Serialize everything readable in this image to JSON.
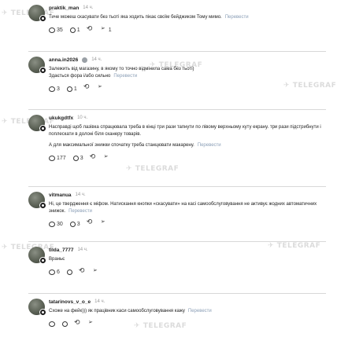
{
  "watermark_text": "TELEGRAF",
  "comments": [
    {
      "username": "praktik_man",
      "time": "14 ч.",
      "paragraphs": [
        "Тиче можеш скасувати без тьотi яка ходить пiкає своїм бейджиком Тому мимо."
      ],
      "translate": "Перевести",
      "likes": "35",
      "replies": "1",
      "shares": "1",
      "verified": false
    },
    {
      "username": "anna.in2026",
      "time": "14 ч.",
      "paragraphs": [
        "Залежить вiд магазину, в якому то точно вiдмiнила сама без тьотi)",
        "Здається фора i/або сильно"
      ],
      "translate": "Перевести",
      "likes": "3",
      "replies": "1",
      "shares": "",
      "verified": true
    },
    {
      "username": "ukukgdtfx",
      "time": "10 ч.",
      "paragraphs": [
        "Насправдi щоб лазiвка спрацювала треба в кiнцi три рази тапнути по лiвому верхньому куту екрану. три рази пiдстрибнути i поплескати в долонi бiля сканеру товарiв.",
        "А для максимальної знижки спочатку треба станцювати макарену."
      ],
      "translate": "Перевести",
      "likes": "177",
      "replies": "3",
      "shares": "",
      "verified": false
    },
    {
      "username": "vitmanua",
      "time": "14 ч.",
      "paragraphs": [
        "Нi, це твердження є мiфом. Натискання кнопки «скасувати» на касi самообслуговування не активує жодних автоматичних знижок."
      ],
      "translate": "Перевести",
      "likes": "30",
      "replies": "3",
      "shares": "",
      "verified": false
    },
    {
      "username": "tilda_7777",
      "time": "14 ч.",
      "paragraphs": [
        "Враньє"
      ],
      "translate": "",
      "likes": "6",
      "replies": "",
      "shares": "",
      "verified": false
    },
    {
      "username": "tatarinovs_v_o_e",
      "time": "14 ч.",
      "paragraphs": [
        "Схоже на фейк))) як працiвник каси самообслуговування кажу"
      ],
      "translate": "Перевести",
      "likes": "",
      "replies": "",
      "shares": "",
      "verified": false
    }
  ]
}
